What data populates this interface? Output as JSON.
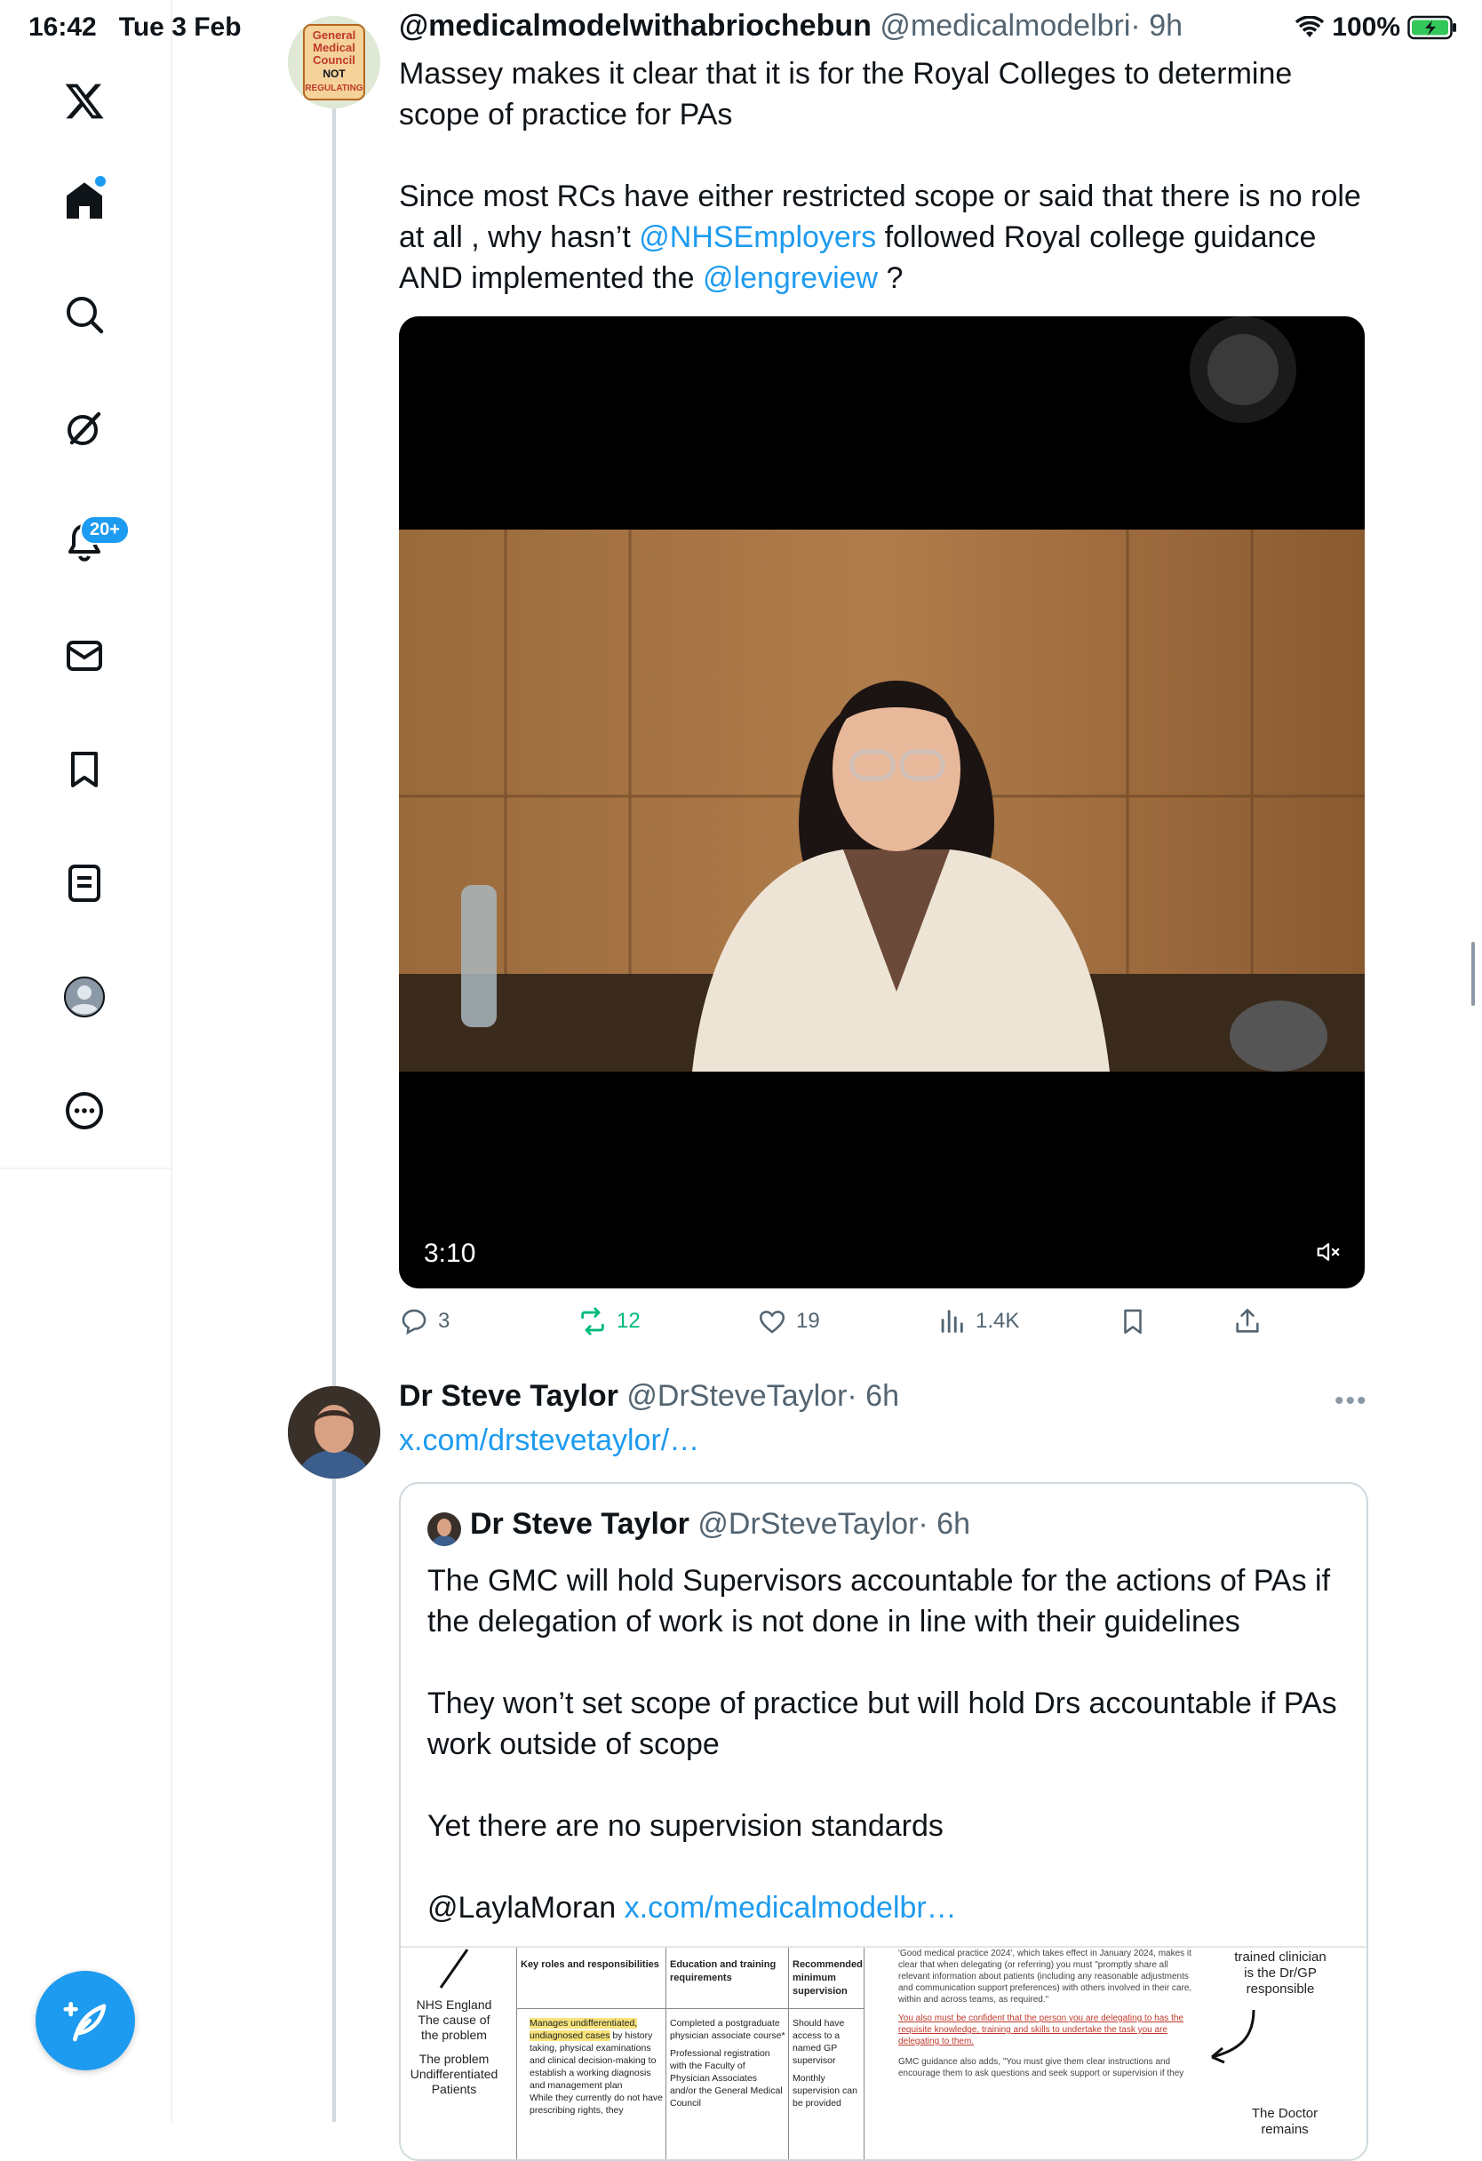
{
  "status": {
    "time": "16:42",
    "date": "Tue 3 Feb",
    "battery": "100%"
  },
  "sidebar": {
    "items": [
      {
        "icon": "x-logo-icon"
      },
      {
        "icon": "home-icon"
      },
      {
        "icon": "search-icon"
      },
      {
        "icon": "grok-icon"
      },
      {
        "icon": "notifications-icon",
        "badge": "20+"
      },
      {
        "icon": "messages-icon"
      },
      {
        "icon": "bookmarks-icon"
      },
      {
        "icon": "lists-icon"
      },
      {
        "icon": "profile-icon"
      },
      {
        "icon": "more-icon"
      }
    ]
  },
  "tweet1": {
    "avatar_lines": [
      "General",
      "Medical",
      "Council",
      "NOT",
      "REGULATING"
    ],
    "display_name": "@medicalmodelwithabriochebun",
    "handle": "@medicalmodelbri",
    "time": "· 9h",
    "text_line1": "Massey makes it clear that it is for the Royal Colleges to determine scope of practice for PAs",
    "text_p2_a": "Since most RCs have either restricted scope or said that there is no role at all , why hasn’t ",
    "mention1": "@NHSEmployers",
    "text_p2_b": " followed Royal college guidance AND implemented the ",
    "mention2": "@lengreview",
    "text_p2_c": " ?",
    "video_duration": "3:10",
    "replies": "3",
    "reposts": "12",
    "likes": "19",
    "views": "1.4K"
  },
  "tweet2": {
    "display_name": "Dr Steve Taylor",
    "handle": "@DrSteveTaylor",
    "time": "· 6h",
    "link": "x.com/drstevetaylor/…",
    "quote": {
      "display_name": "Dr Steve Taylor",
      "handle": "@DrSteveTaylor",
      "time": "· 6h",
      "p1": "The GMC will hold Supervisors accountable for the actions of PAs if the delegation of work is not done in line with their guidelines",
      "p2": "They won’t set scope of practice but will hold Drs accountable if PAs work outside of scope",
      "p3": "Yet there are no supervision standards",
      "p4_mention": "@LaylaMoran",
      "p4_link": "x.com/medicalmodelbr…"
    }
  },
  "doc_image": {
    "left_label_1": "NHS England",
    "left_label_2": "The cause of",
    "left_label_3": "the problem",
    "left_label_4": "The problem",
    "left_label_5": "Undifferentiated",
    "left_label_6": "Patients",
    "col1_header": "Key roles and responsibilities",
    "col2_header": "Education and training requirements",
    "col3_header": "Recommended minimum supervision",
    "col1_text_hl": "Manages undifferentiated, undiagnosed cases",
    "col1_text": "by history taking, physical examinations and clinical decision-making to establish a working diagnosis and management plan",
    "col1_text2": "While they currently do not have prescribing rights, they",
    "col2_text": "Completed a postgraduate physician associate course*",
    "col2_text2": "Professional registration with the Faculty of Physician Associates and/or the General Medical Council",
    "col3_text": "Should have access to a named GP supervisor",
    "col3_text2": "Monthly supervision can be provided",
    "gmc_text1": "'Good medical practice 2024', which takes effect in January 2024, makes it clear that when delegating (or referring) you must \"promptly share all relevant information about patients (including any reasonable adjustments and communication support preferences) with others involved in their care, within and across teams, as required.\"",
    "gmc_text2": "You also must be confident that the person you are delegating to has the requisite knowledge, training and skills to undertake the task you are delegating to them.",
    "gmc_text3": "GMC guidance also adds, \"You must give them clear instructions and encourage them to ask questions and seek support or supervision if they",
    "right_label_1": "trained clinician",
    "right_label_2": "is the Dr/GP",
    "right_label_3": "responsible",
    "right_label_4": "The Doctor",
    "right_label_5": "remains"
  }
}
